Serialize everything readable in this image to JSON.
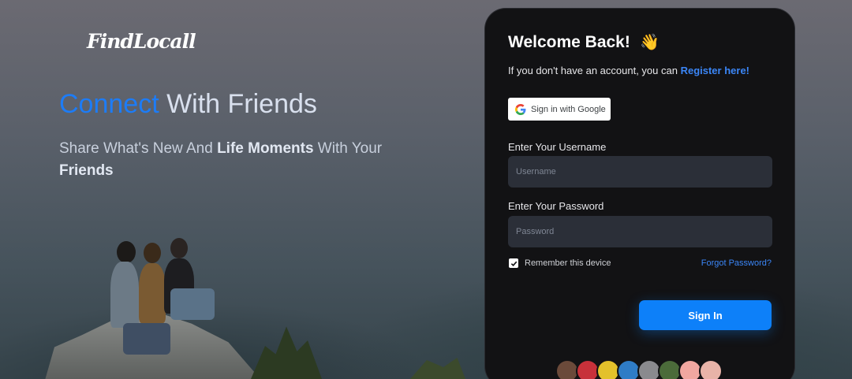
{
  "brand": {
    "logo_text": "FindLocall"
  },
  "hero": {
    "headline_accent": "Connect",
    "headline_rest": " With Friends",
    "subtitle_part1": "Share What's New And ",
    "subtitle_bold1": "Life Moments",
    "subtitle_part2": " With Your ",
    "subtitle_bold2": "Friends"
  },
  "login": {
    "title": "Welcome Back!",
    "wave_emoji": "👋",
    "register_prompt": "If you don't have an account, you can ",
    "register_link": "Register here!",
    "google_button": "Sign in with Google",
    "username_label": "Enter Your Username",
    "username_placeholder": "Username",
    "password_label": "Enter Your Password",
    "password_placeholder": "Password",
    "remember_label": "Remember this device",
    "remember_checked": true,
    "forgot_link": "Forgot Password?",
    "signin_button": "Sign In"
  },
  "avatars": {
    "items": [
      {
        "name": "avatar-1",
        "color": "#6b4a3a"
      },
      {
        "name": "avatar-2",
        "color": "#c7313a"
      },
      {
        "name": "avatar-3",
        "color": "#e3c12b"
      },
      {
        "name": "avatar-4",
        "color": "#2f7cc6"
      },
      {
        "name": "avatar-5",
        "color": "#8a8a8e"
      },
      {
        "name": "avatar-6",
        "color": "#4b6b3a"
      },
      {
        "name": "avatar-7",
        "color": "#f1a7a0"
      },
      {
        "name": "avatar-8",
        "color": "#e8b3a8"
      }
    ]
  },
  "colors": {
    "accent": "#1d7cf6",
    "card_bg": "#121214",
    "button": "#0d80f9"
  }
}
